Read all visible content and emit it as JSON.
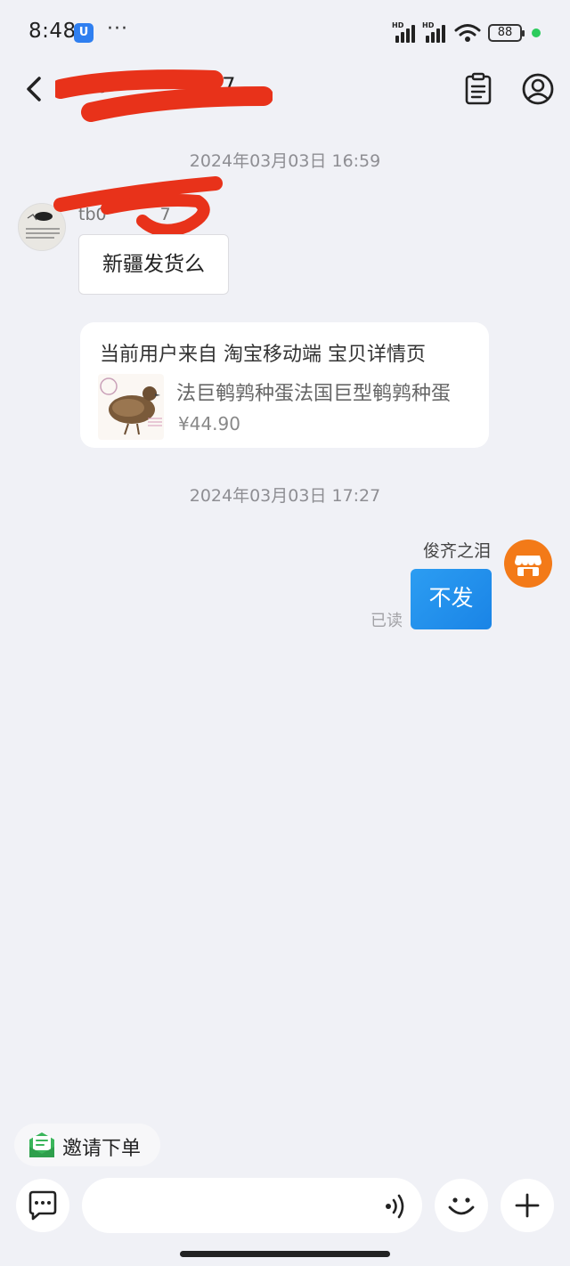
{
  "status_bar": {
    "time": "8:48",
    "app_badge": "U",
    "dots": "···",
    "hd1": "HD",
    "hd2": "HD",
    "battery": "88"
  },
  "header": {
    "title": "tb0",
    "title_suffix": "27"
  },
  "messages": {
    "timestamp1": "2024年03月03日 16:59",
    "sender_name": "tb0",
    "sender_suffix": "7",
    "text1": "新疆发货么",
    "product_card": {
      "source": "当前用户来自  淘宝移动端  宝贝详情页",
      "title": "法巨鹌鹑种蛋法国巨型鹌鹑种蛋",
      "price": "¥44.90"
    },
    "timestamp2": "2024年03月03日 17:27",
    "my_name": "俊齐之泪",
    "reply": "不发",
    "read_status": "已读"
  },
  "actions": {
    "invite": "邀请下单"
  },
  "input": {
    "placeholder": ""
  },
  "colors": {
    "background": "#f0f1f6",
    "reply_bubble": "#1a84e6",
    "redaction": "#e8321a",
    "shop_avatar": "#f37a18",
    "invite_icon": "#3ab55b"
  },
  "icons": [
    "back-icon",
    "order-list-icon",
    "profile-icon",
    "store-icon",
    "invite-order-icon",
    "chat-bubble-icon",
    "voice-icon",
    "emoji-icon",
    "plus-icon"
  ]
}
